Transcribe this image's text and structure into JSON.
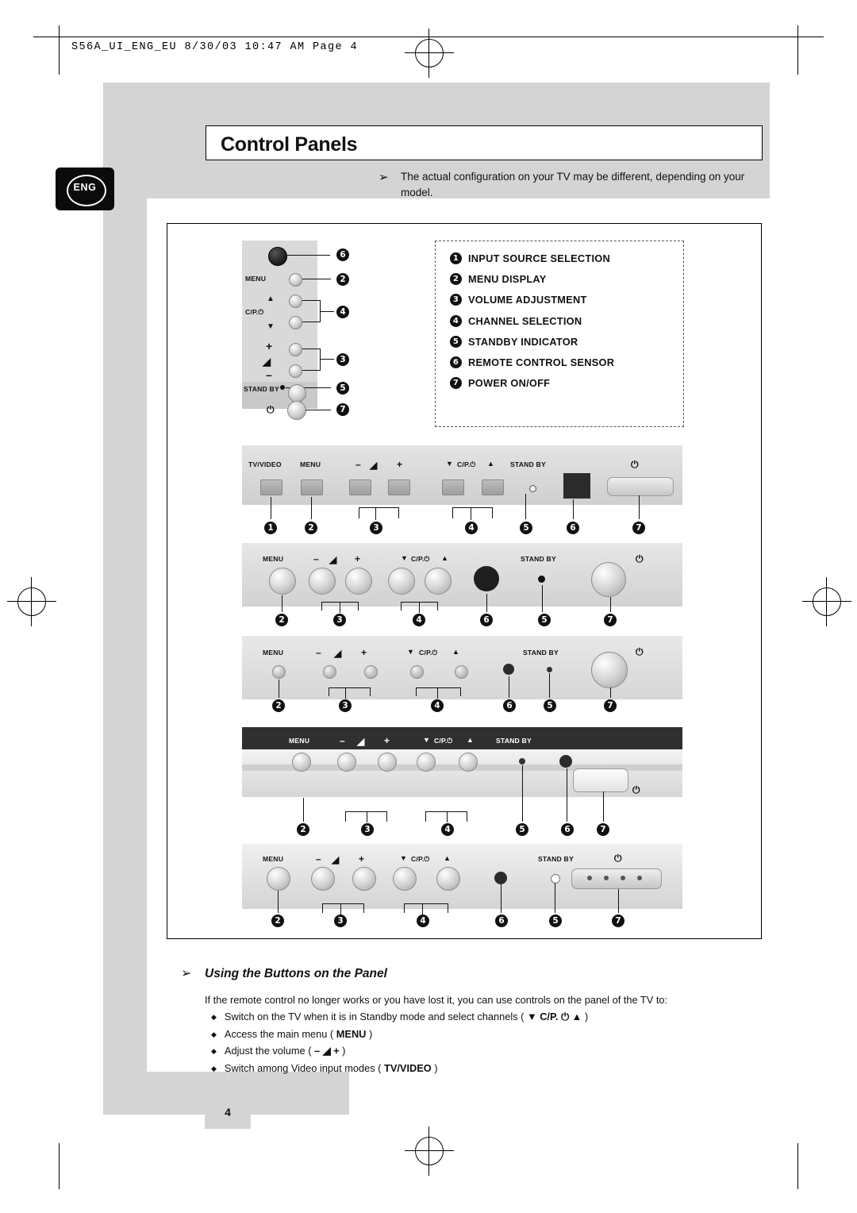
{
  "header": {
    "print_line": "S56A_UI_ENG_EU  8/30/03  10:47 AM  Page  4"
  },
  "title": "Control Panels",
  "lang_badge": "ENG",
  "note": {
    "arrow": "➢",
    "text": "The actual configuration on your TV may be different, depending on your model."
  },
  "legend": {
    "items": [
      {
        "num": "1",
        "label": "INPUT SOURCE SELECTION"
      },
      {
        "num": "2",
        "label": "MENU DISPLAY"
      },
      {
        "num": "3",
        "label": "VOLUME ADJUSTMENT"
      },
      {
        "num": "4",
        "label": "CHANNEL SELECTION"
      },
      {
        "num": "5",
        "label": "STANDBY INDICATOR"
      },
      {
        "num": "6",
        "label": "REMOTE CONTROL SENSOR"
      },
      {
        "num": "7",
        "label": "POWER ON/OFF"
      }
    ]
  },
  "panels": {
    "vertical": {
      "labels": {
        "menu": "MENU",
        "cp": "C/P.",
        "standby": "STAND BY",
        "plus": "+",
        "minus": "–",
        "up": "▲",
        "down": "▼",
        "power": "⏻"
      },
      "callouts": [
        "6",
        "2",
        "4",
        "3",
        "5",
        "7"
      ]
    },
    "row1": {
      "labels": {
        "tvvideo": "TV/VIDEO",
        "menu": "MENU",
        "minus": "–",
        "plus": "+",
        "cp": "C/P.",
        "down": "▼",
        "up": "▲",
        "standby": "STAND BY",
        "power": "⏻"
      },
      "callouts": [
        "1",
        "2",
        "3",
        "4",
        "5",
        "6",
        "7"
      ]
    },
    "row2": {
      "labels": {
        "menu": "MENU",
        "minus": "–",
        "plus": "+",
        "cp": "C/P.",
        "down": "▼",
        "up": "▲",
        "standby": "STAND BY",
        "power": "⏻"
      },
      "callouts": [
        "2",
        "3",
        "4",
        "6",
        "5",
        "7"
      ]
    },
    "row3": {
      "labels": {
        "menu": "MENU",
        "minus": "–",
        "plus": "+",
        "cp": "C/P.",
        "down": "▼",
        "up": "▲",
        "standby": "STAND BY",
        "power": "⏻"
      },
      "callouts": [
        "2",
        "3",
        "4",
        "6",
        "5",
        "7"
      ]
    },
    "row4": {
      "labels": {
        "menu": "MENU",
        "minus": "–",
        "plus": "+",
        "cp": "C/P.",
        "down": "▼",
        "up": "▲",
        "standby": "STAND BY",
        "power": "⏻"
      },
      "callouts": [
        "2",
        "3",
        "4",
        "5",
        "6",
        "7"
      ]
    },
    "row5": {
      "labels": {
        "menu": "MENU",
        "minus": "–",
        "plus": "+",
        "cp": "C/P.",
        "down": "▼",
        "up": "▲",
        "standby": "STAND BY",
        "power": "⏻"
      },
      "callouts": [
        "2",
        "3",
        "4",
        "6",
        "5",
        "7"
      ]
    }
  },
  "section": {
    "arrow": "➢",
    "heading": "Using the Buttons on the Panel",
    "intro": "If the remote control no longer works or you have lost it, you can use controls on the panel of the TV to:",
    "bullets": [
      {
        "marker": "◆",
        "pre": "Switch on the TV when it is in Standby mode and select channels ( ",
        "bold": "▼ C/P.  ⏻  ▲",
        "post": " )"
      },
      {
        "marker": "◆",
        "pre": "Access the main menu ( ",
        "bold": "MENU",
        "post": " )"
      },
      {
        "marker": "◆",
        "pre": "Adjust the volume ( ",
        "bold": "–  ◢  +",
        "post": " )"
      },
      {
        "marker": "◆",
        "pre": "Switch among Video input modes ( ",
        "bold": "TV/VIDEO",
        "post": " )"
      }
    ]
  },
  "page_number": "4",
  "colors": {
    "grey_band": "#d4d4d4",
    "panel_grey": "#dadada",
    "ink": "#111111"
  }
}
